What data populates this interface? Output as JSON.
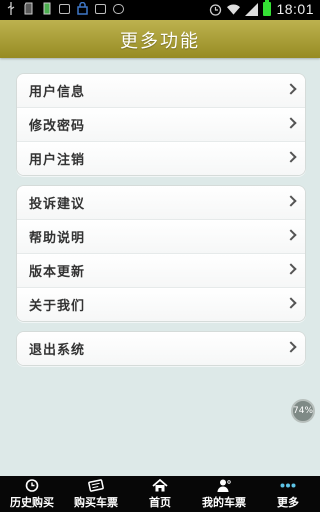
{
  "status_bar": {
    "time": "18:01",
    "icons": [
      "usb-icon",
      "sd-card-icon",
      "battery-status-icon",
      "image-icon",
      "lock-icon",
      "screenshot-icon",
      "store-icon",
      "alarm-icon",
      "wifi-icon",
      "signal-icon",
      "battery-icon"
    ]
  },
  "header": {
    "title": "更多功能"
  },
  "groups": [
    {
      "items": [
        {
          "label": "用户信息"
        },
        {
          "label": "修改密码"
        },
        {
          "label": "用户注销"
        }
      ]
    },
    {
      "items": [
        {
          "label": "投诉建议"
        },
        {
          "label": "帮助说明"
        },
        {
          "label": "版本更新"
        },
        {
          "label": "关于我们"
        }
      ]
    },
    {
      "items": [
        {
          "label": "退出系统"
        }
      ]
    }
  ],
  "badge": {
    "text": "74%"
  },
  "tabbar": {
    "items": [
      {
        "label": "历史购买",
        "icon": "clock-icon"
      },
      {
        "label": "购买车票",
        "icon": "ticket-icon"
      },
      {
        "label": "首页",
        "icon": "home-icon"
      },
      {
        "label": "我的车票",
        "icon": "user-icon"
      },
      {
        "label": "更多",
        "icon": "more-icon"
      }
    ]
  },
  "colors": {
    "header": "#a89c33",
    "background": "#dde9e8",
    "tabbar": "#070707",
    "more_dots": "#5ec4e6"
  }
}
